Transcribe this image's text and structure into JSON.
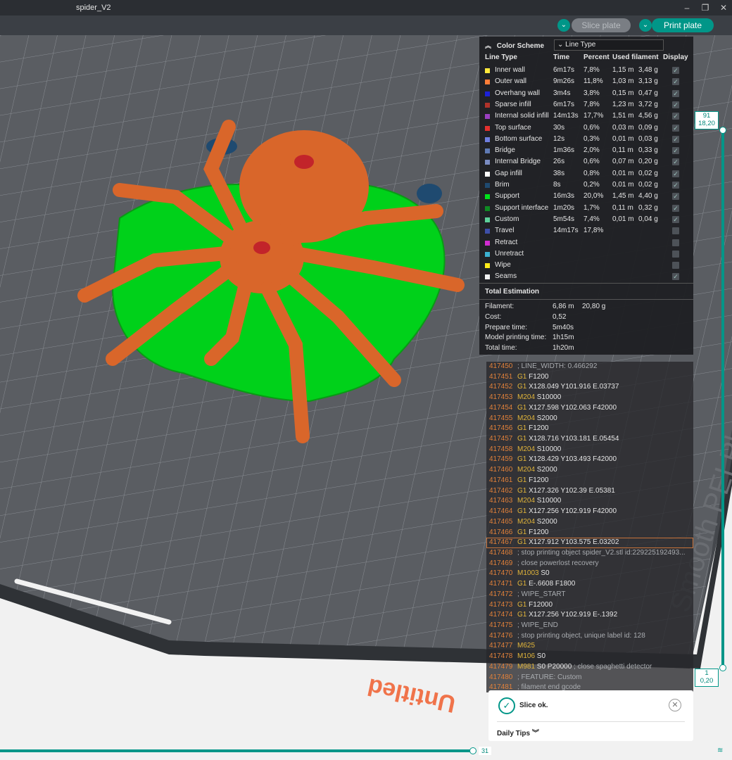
{
  "window": {
    "title": "spider_V2"
  },
  "toolbar": {
    "slice_label": "Slice plate",
    "print_label": "Print plate"
  },
  "plate": {
    "watermark": "Untitled",
    "plate_text": "Smooth PEI Plate / High Temp"
  },
  "legend": {
    "title": "Color Scheme",
    "scheme_selected": "Line Type",
    "columns": {
      "line_type": "Line Type",
      "time": "Time",
      "percent": "Percent",
      "filament": "Used filament",
      "display": "Display"
    },
    "rows": [
      {
        "name": "Inner wall",
        "color": "#ffe93b",
        "time": "6m17s",
        "percent": "7,8%",
        "length": "1,15 m",
        "grams": "3,48 g",
        "shown": true
      },
      {
        "name": "Outer wall",
        "color": "#ff7d38",
        "time": "9m26s",
        "percent": "11,8%",
        "length": "1,03 m",
        "grams": "3,13 g",
        "shown": true
      },
      {
        "name": "Overhang wall",
        "color": "#1c21d8",
        "time": "3m4s",
        "percent": "3,8%",
        "length": "0,15 m",
        "grams": "0,47 g",
        "shown": true
      },
      {
        "name": "Sparse infill",
        "color": "#b0322a",
        "time": "6m17s",
        "percent": "7,8%",
        "length": "1,23 m",
        "grams": "3,72 g",
        "shown": true
      },
      {
        "name": "Internal solid infill",
        "color": "#9a3fc0",
        "time": "14m13s",
        "percent": "17,7%",
        "length": "1,51 m",
        "grams": "4,56 g",
        "shown": true
      },
      {
        "name": "Top surface",
        "color": "#e3302e",
        "time": "30s",
        "percent": "0,6%",
        "length": "0,03 m",
        "grams": "0,09 g",
        "shown": true
      },
      {
        "name": "Bottom surface",
        "color": "#6f7ee0",
        "time": "12s",
        "percent": "0,3%",
        "length": "0,01 m",
        "grams": "0,03 g",
        "shown": true
      },
      {
        "name": "Bridge",
        "color": "#5f7ab5",
        "time": "1m36s",
        "percent": "2,0%",
        "length": "0,11 m",
        "grams": "0,33 g",
        "shown": true
      },
      {
        "name": "Internal Bridge",
        "color": "#7a8cc2",
        "time": "26s",
        "percent": "0,6%",
        "length": "0,07 m",
        "grams": "0,20 g",
        "shown": true
      },
      {
        "name": "Gap infill",
        "color": "#ffffff",
        "time": "38s",
        "percent": "0,8%",
        "length": "0,01 m",
        "grams": "0,02 g",
        "shown": true
      },
      {
        "name": "Brim",
        "color": "#1f4a70",
        "time": "8s",
        "percent": "0,2%",
        "length": "0,01 m",
        "grams": "0,02 g",
        "shown": true
      },
      {
        "name": "Support",
        "color": "#00e21a",
        "time": "16m3s",
        "percent": "20,0%",
        "length": "1,45 m",
        "grams": "4,40 g",
        "shown": true
      },
      {
        "name": "Support interface",
        "color": "#0f8a23",
        "time": "1m20s",
        "percent": "1,7%",
        "length": "0,11 m",
        "grams": "0,32 g",
        "shown": true
      },
      {
        "name": "Custom",
        "color": "#5dd19a",
        "time": "5m54s",
        "percent": "7,4%",
        "length": "0,01 m",
        "grams": "0,04 g",
        "shown": true
      },
      {
        "name": "Travel",
        "color": "#3d4fa8",
        "time": "14m17s",
        "percent": "17,8%",
        "length": "",
        "grams": "",
        "shown": false
      },
      {
        "name": "Retract",
        "color": "#d12cd1",
        "time": "",
        "percent": "",
        "length": "",
        "grams": "",
        "shown": false
      },
      {
        "name": "Unretract",
        "color": "#3bb1d1",
        "time": "",
        "percent": "",
        "length": "",
        "grams": "",
        "shown": false
      },
      {
        "name": "Wipe",
        "color": "#ffeb1a",
        "time": "",
        "percent": "",
        "length": "",
        "grams": "",
        "shown": false
      },
      {
        "name": "Seams",
        "color": "#f2f2f2",
        "time": "",
        "percent": "",
        "length": "",
        "grams": "",
        "shown": true
      }
    ],
    "total": {
      "title": "Total Estimation",
      "items": [
        {
          "k": "Filament:",
          "v": "6,86 m",
          "v2": "20,80 g"
        },
        {
          "k": "Cost:",
          "v": "0,52",
          "v2": ""
        },
        {
          "k": "Prepare time:",
          "v": "5m40s",
          "v2": ""
        },
        {
          "k": "Model printing time:",
          "v": "1h15m",
          "v2": ""
        },
        {
          "k": "Total time:",
          "v": "1h20m",
          "v2": ""
        }
      ]
    }
  },
  "gcode": [
    {
      "ln": "417450",
      "cmd": "",
      "args": "",
      "cmt": "; LINE_WIDTH: 0.466292"
    },
    {
      "ln": "417451",
      "cmd": "G1",
      "args": "F1200",
      "cmt": ""
    },
    {
      "ln": "417452",
      "cmd": "G1",
      "args": "X128.049 Y101.916 E.03737",
      "cmt": ""
    },
    {
      "ln": "417453",
      "cmd": "M204",
      "args": "S10000",
      "cmt": ""
    },
    {
      "ln": "417454",
      "cmd": "G1",
      "args": "X127.598 Y102.063 F42000",
      "cmt": ""
    },
    {
      "ln": "417455",
      "cmd": "M204",
      "args": "S2000",
      "cmt": ""
    },
    {
      "ln": "417456",
      "cmd": "G1",
      "args": "F1200",
      "cmt": ""
    },
    {
      "ln": "417457",
      "cmd": "G1",
      "args": "X128.716 Y103.181 E.05454",
      "cmt": ""
    },
    {
      "ln": "417458",
      "cmd": "M204",
      "args": "S10000",
      "cmt": ""
    },
    {
      "ln": "417459",
      "cmd": "G1",
      "args": "X128.429 Y103.493 F42000",
      "cmt": ""
    },
    {
      "ln": "417460",
      "cmd": "M204",
      "args": "S2000",
      "cmt": ""
    },
    {
      "ln": "417461",
      "cmd": "G1",
      "args": "F1200",
      "cmt": ""
    },
    {
      "ln": "417462",
      "cmd": "G1",
      "args": "X127.326 Y102.39 E.05381",
      "cmt": ""
    },
    {
      "ln": "417463",
      "cmd": "M204",
      "args": "S10000",
      "cmt": ""
    },
    {
      "ln": "417464",
      "cmd": "G1",
      "args": "X127.256 Y102.919 F42000",
      "cmt": ""
    },
    {
      "ln": "417465",
      "cmd": "M204",
      "args": "S2000",
      "cmt": ""
    },
    {
      "ln": "417466",
      "cmd": "G1",
      "args": "F1200",
      "cmt": ""
    },
    {
      "ln": "417467",
      "cmd": "G1",
      "args": "X127.912 Y103.575 E.03202",
      "cmt": "",
      "hl": true
    },
    {
      "ln": "417468",
      "cmd": "",
      "args": "",
      "cmt": "; stop printing object spider_V2.stl id:229225192493..."
    },
    {
      "ln": "417469",
      "cmd": "",
      "args": "",
      "cmt": "; close powerlost recovery"
    },
    {
      "ln": "417470",
      "cmd": "M1003",
      "args": "S0",
      "cmt": ""
    },
    {
      "ln": "417471",
      "cmd": "G1",
      "args": "E-.6608 F1800",
      "cmt": ""
    },
    {
      "ln": "417472",
      "cmd": "",
      "args": "",
      "cmt": "; WIPE_START"
    },
    {
      "ln": "417473",
      "cmd": "G1",
      "args": "F12000",
      "cmt": ""
    },
    {
      "ln": "417474",
      "cmd": "G1",
      "args": "X127.256 Y102.919 E-.1392",
      "cmt": ""
    },
    {
      "ln": "417475",
      "cmd": "",
      "args": "",
      "cmt": "; WIPE_END"
    },
    {
      "ln": "417476",
      "cmd": "",
      "args": "",
      "cmt": "; stop printing object, unique label id: 128"
    },
    {
      "ln": "417477",
      "cmd": "M625",
      "args": "",
      "cmt": ""
    },
    {
      "ln": "417478",
      "cmd": "M106",
      "args": "S0",
      "cmt": ""
    },
    {
      "ln": "417479",
      "cmd": "M981",
      "args": "S0 P20000",
      "cmt": " ; close spaghetti detector"
    },
    {
      "ln": "417480",
      "cmd": "",
      "args": "",
      "cmt": "; FEATURE: Custom"
    },
    {
      "ln": "417481",
      "cmd": "",
      "args": "",
      "cmt": "; filament end gcode"
    }
  ],
  "layer_slider": {
    "top_layer": "91",
    "top_height": "18,20",
    "bottom_layer": "1",
    "bottom_height": "0,20"
  },
  "move_slider": {
    "value": "31"
  },
  "notification": {
    "message": "Slice ok.",
    "tips_label": "Daily Tips"
  },
  "colors": {
    "accent": "#009688",
    "model_orange": "#d9662a",
    "support_green": "#00d11a"
  }
}
